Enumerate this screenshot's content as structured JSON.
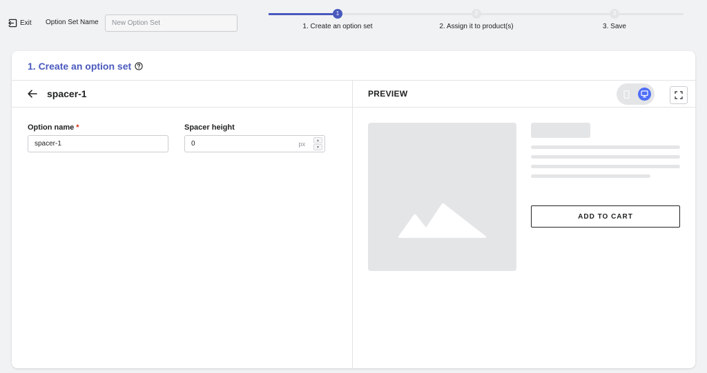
{
  "topbar": {
    "exit_label": "Exit",
    "option_set_name_label": "Option Set Name",
    "option_set_name_placeholder": "New Option Set",
    "option_set_name_value": ""
  },
  "stepper": {
    "steps": [
      {
        "number": "1",
        "label": "1. Create an option set",
        "state": "active"
      },
      {
        "number": "2",
        "label": "2. Assign it to product(s)",
        "state": "pending"
      },
      {
        "number": "3",
        "label": "3. Save",
        "state": "pending"
      }
    ]
  },
  "card": {
    "title": "1. Create an option set"
  },
  "editor": {
    "element_name": "spacer-1",
    "option_name_label": "Option name",
    "option_name_required": "*",
    "option_name_value": "spacer-1",
    "spacer_height_label": "Spacer height",
    "spacer_height_value": "0",
    "spacer_height_unit": "px"
  },
  "preview": {
    "title": "PREVIEW",
    "device_selected": "desktop",
    "add_to_cart_label": "ADD TO CART"
  },
  "colors": {
    "accent": "#4959bd",
    "toggle_active": "#4f6ef7",
    "required": "#d72c0d",
    "placeholder_gray": "#e4e5e7"
  },
  "icons": {
    "exit": "exit-icon",
    "help": "help-icon",
    "back": "arrow-left-icon",
    "mobile": "mobile-icon",
    "desktop": "desktop-icon",
    "fullscreen": "fullscreen-icon",
    "image": "image-placeholder-icon"
  }
}
